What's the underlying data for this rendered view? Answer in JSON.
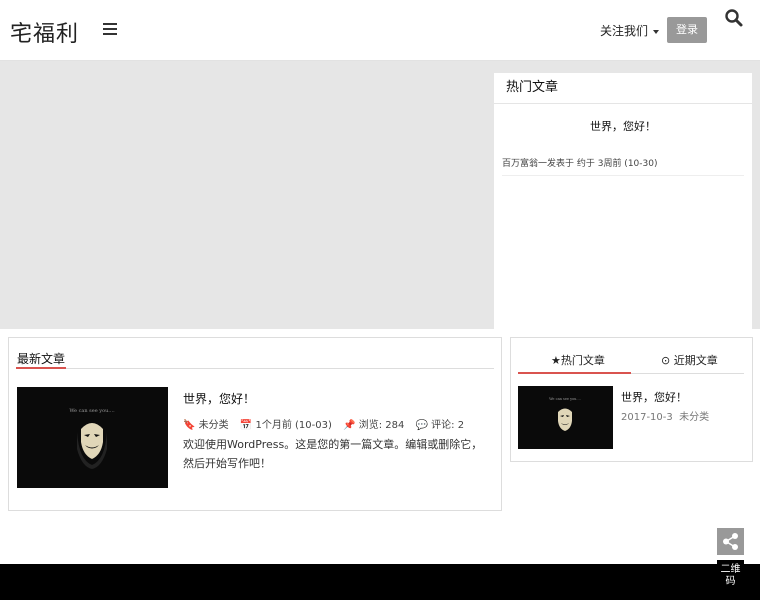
{
  "header": {
    "logo": "宅福利",
    "follow_label": "关注我们",
    "login_label": "登录"
  },
  "sidebar": {
    "title": "热门文章",
    "post_title": "世界，您好！",
    "post_meta": "百万富翁一发表于 约于 3周前 (10-30)"
  },
  "latest": {
    "title": "最新文章",
    "article": {
      "title": "世界，您好！",
      "category": "未分类",
      "date": "1个月前 (10-03)",
      "views_label": "浏览: 284",
      "comments_label": "评论: 2",
      "excerpt": "欢迎使用WordPress。这是您的第一篇文章。编辑或删除它，然后开始写作吧！"
    }
  },
  "tabs": {
    "tab1_label": "热门文章",
    "tab2_label": "近期文章",
    "post_title": "世界，您好！",
    "post_date": "2017-10-3",
    "post_category": "未分类"
  },
  "float": {
    "extra_label": "二维码"
  }
}
